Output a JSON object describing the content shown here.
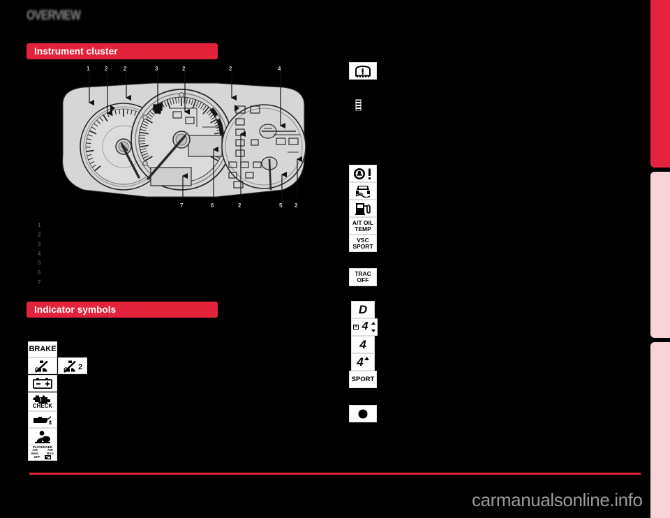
{
  "page": {
    "running_head": "OVERVIEW",
    "watermark": "carmanualsonline.info",
    "accent_red": "#e3233c",
    "tab_red": "#e8233f",
    "tab_pink": "#f9d2d9",
    "background": "#000000"
  },
  "sections": {
    "cluster": {
      "title": "Instrument cluster"
    },
    "symbols": {
      "title": "Indicator symbols"
    }
  },
  "cluster_diagram": {
    "callouts_top": [
      "1",
      "2",
      "2",
      "3",
      "2",
      "2",
      "4"
    ],
    "callouts_bottom": [
      "7",
      "6",
      "2",
      "5",
      "2"
    ]
  },
  "legend": {
    "items": [
      {
        "num": "1",
        "text": ""
      },
      {
        "num": "2",
        "text": ""
      },
      {
        "num": "3",
        "text": ""
      },
      {
        "num": "4",
        "text": ""
      },
      {
        "num": "5",
        "text": ""
      },
      {
        "num": "6",
        "text": ""
      },
      {
        "num": "7",
        "text": ""
      }
    ]
  },
  "indicator_symbols": {
    "left_column": [
      {
        "id": "brake-warning",
        "label": "BRAKE"
      },
      {
        "id": "seat-belt-reminder",
        "label": ""
      },
      {
        "id": "seat-belt-reminder-2",
        "label": "2"
      },
      {
        "id": "charging-system-warning",
        "label": ""
      },
      {
        "id": "check-engine-warning",
        "label": "CHECK"
      },
      {
        "id": "low-oil-pressure-warning",
        "label": ""
      },
      {
        "id": "srs-airbag-warning",
        "label": ""
      },
      {
        "id": "passenger-airbag-off",
        "label_line1": "PASSENGER",
        "label_line2a": "AIR BAG",
        "label_line2b": "AIR BAG",
        "label_line3": "OFF"
      }
    ],
    "right_column": [
      {
        "id": "tire-pressure-warning",
        "label": ""
      },
      {
        "id": "door-ajar-indicator",
        "label": ""
      },
      {
        "id": "power-steering-warning",
        "label": ""
      },
      {
        "id": "vsc-slip-indicator",
        "label": ""
      },
      {
        "id": "low-fuel-level",
        "label": ""
      },
      {
        "id": "at-oil-temp-warning",
        "label_line1": "A/T OIL",
        "label_line2": "TEMP"
      },
      {
        "id": "vsc-sport-indicator",
        "label_line1": "VSC",
        "label_line2": "SPORT"
      },
      {
        "id": "trac-off-indicator",
        "label_line1": "TRAC",
        "label_line2": "OFF"
      },
      {
        "id": "shift-position-d",
        "label": "D"
      },
      {
        "id": "shift-position-m4",
        "label_m": "M",
        "label": "4"
      },
      {
        "id": "shift-position-4",
        "label": "4"
      },
      {
        "id": "shift-position-4-up",
        "label": "4"
      },
      {
        "id": "sport-mode-indicator",
        "label": "SPORT"
      },
      {
        "id": "dot-indicator",
        "label": ""
      }
    ]
  }
}
